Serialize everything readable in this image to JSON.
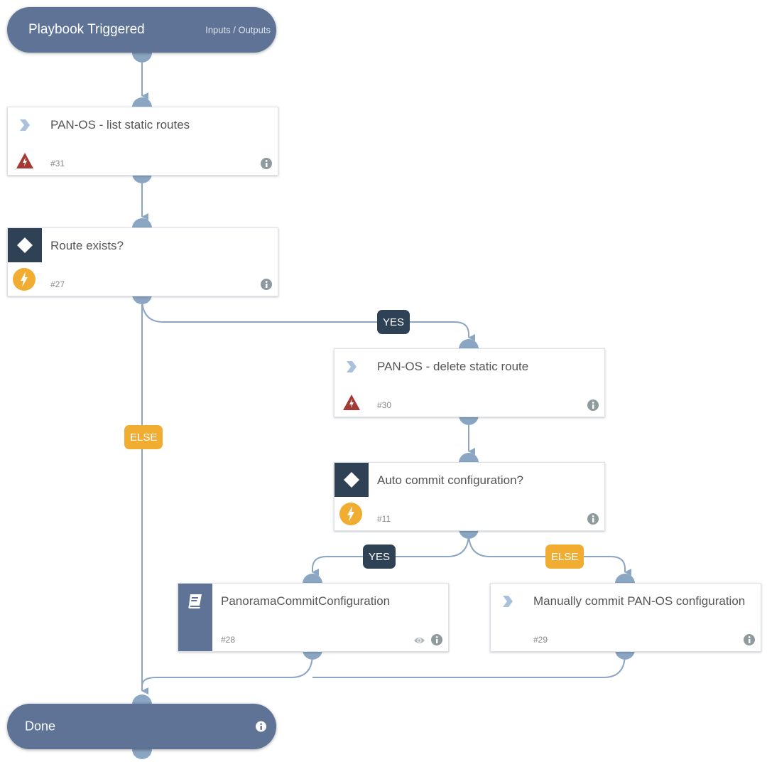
{
  "start": {
    "title": "Playbook Triggered",
    "io_link": "Inputs / Outputs"
  },
  "tasks": [
    {
      "id": "31",
      "number": "#31",
      "label": "PAN-OS - list static routes",
      "type": "playbook"
    },
    {
      "id": "27",
      "number": "#27",
      "label": "Route exists?",
      "type": "condition"
    },
    {
      "id": "30",
      "number": "#30",
      "label": "PAN-OS - delete static route",
      "type": "playbook"
    },
    {
      "id": "11",
      "number": "#11",
      "label": "Auto commit configuration?",
      "type": "condition"
    },
    {
      "id": "28",
      "number": "#28",
      "label": "PanoramaCommitConfiguration",
      "type": "command"
    },
    {
      "id": "29",
      "number": "#29",
      "label": "Manually commit PAN-OS configuration",
      "type": "playbook"
    }
  ],
  "branches": {
    "route_yes": "YES",
    "route_else": "ELSE",
    "commit_yes": "YES",
    "commit_else": "ELSE"
  },
  "end": {
    "title": "Done"
  },
  "colors": {
    "node": "#5e7396",
    "connector": "#8aa6c3",
    "condition": "#2f4155",
    "else": "#f0ad32",
    "error": "#a33b34"
  }
}
